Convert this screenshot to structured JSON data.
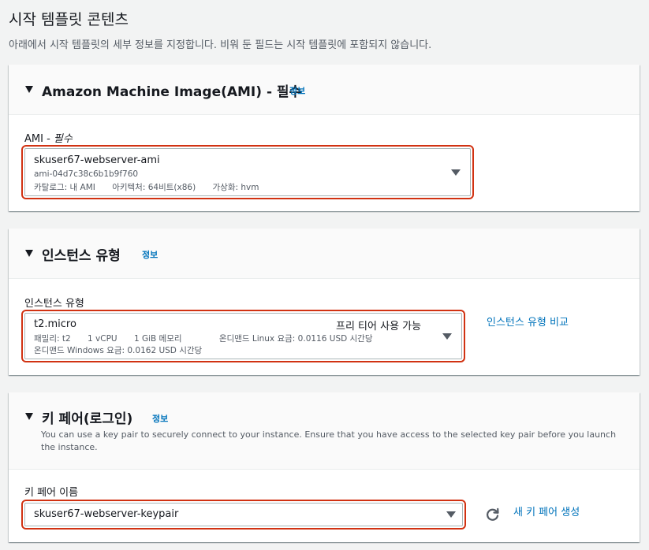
{
  "page": {
    "title": "시작 템플릿 콘텐츠",
    "description": "아래에서 시작 템플릿의 세부 정보를 지정합니다. 비워 둔 필드는 시작 템플릿에 포함되지 않습니다."
  },
  "ami": {
    "title": "Amazon Machine Image(AMI) - 필수",
    "info": "정보",
    "field_label": "AMI - ",
    "field_label_hint": "필수",
    "selected_name": "skuser67-webserver-ami",
    "selected_id": "ami-04d7c38c6b1b9f760",
    "catalog": "카탈로그: 내 AMI",
    "architecture": "아키텍처: 64비트(x86)",
    "virtualization": "가상화: hvm"
  },
  "instance": {
    "title": "인스턴스 유형",
    "info": "정보",
    "field_label": "인스턴스 유형",
    "selected": "t2.micro",
    "free_tier": "프리 티어 사용 가능",
    "family": "패밀리: t2",
    "vcpu": "1 vCPU",
    "memory": "1 GiB 메모리",
    "linux_price": "온디맨드 Linux 요금: 0.0116 USD 시간당",
    "windows_price": "온디맨드 Windows 요금: 0.0162 USD 시간당",
    "compare_link": "인스턴스 유형 비교"
  },
  "keypair": {
    "title": "키 페어(로그인)",
    "info": "정보",
    "description": "You can use a key pair to securely connect to your instance. Ensure that you have access to the selected key pair before you launch the instance.",
    "field_label": "키 페어 이름",
    "selected": "skuser67-webserver-keypair",
    "create_link": "새 키 페어 생성"
  },
  "icons": {
    "collapse": "caret-down-icon",
    "dropdown": "dropdown-arrow-icon",
    "refresh": "refresh-icon"
  },
  "colors": {
    "link": "#0073bb",
    "highlight": "#d13212",
    "background": "#f2f3f3"
  }
}
